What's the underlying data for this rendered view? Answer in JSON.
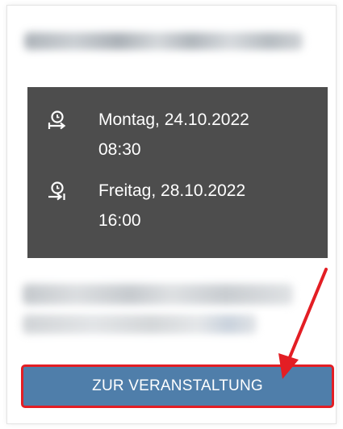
{
  "event_card": {
    "start": {
      "icon": "clock-start-icon",
      "date": "Montag, 24.10.2022",
      "time": "08:30"
    },
    "end": {
      "icon": "clock-end-icon",
      "date": "Freitag, 28.10.2022",
      "time": "16:00"
    },
    "cta_label": "ZUR VERANSTALTUNG"
  },
  "colors": {
    "dates_background": "#4d4d4d",
    "button_background": "#4f7eaa",
    "highlight": "#e31e24"
  }
}
